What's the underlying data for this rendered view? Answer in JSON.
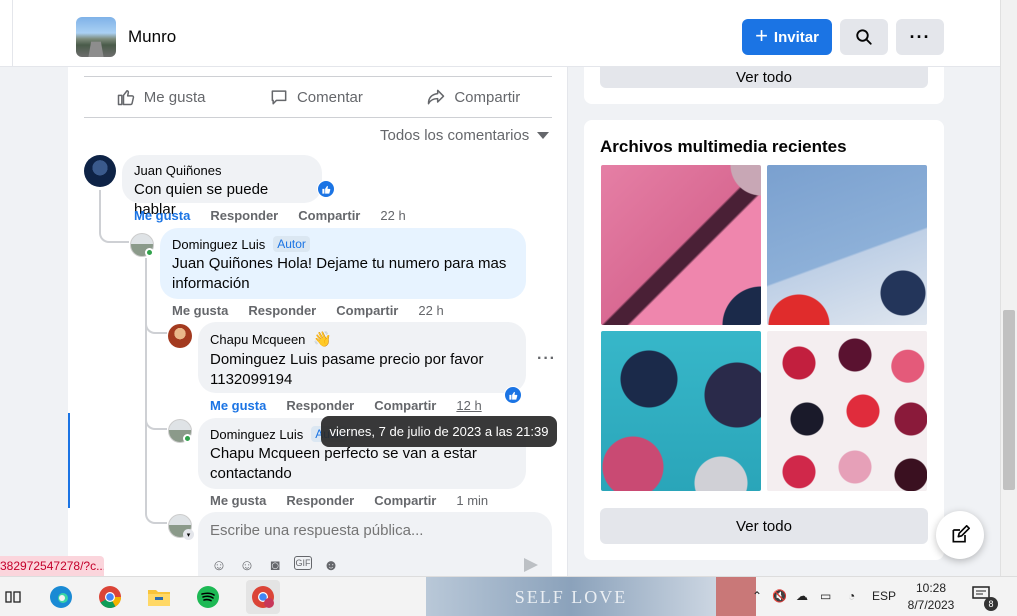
{
  "header": {
    "group_name": "Munro",
    "invite_label": "Invitar",
    "thumb_icon": "group-photo"
  },
  "post_actions": {
    "like": "Me gusta",
    "comment": "Comentar",
    "share": "Compartir"
  },
  "filter_label": "Todos los comentarios",
  "comments": [
    {
      "author": "Juan Quiñones",
      "text": "Con quien se puede hablar",
      "actions": [
        "Me gusta",
        "Responder",
        "Compartir"
      ],
      "time": "22 h",
      "liked": true
    },
    {
      "author": "Dominguez Luis",
      "badge": "Autor",
      "mention": "Juan Quiñones",
      "text": " Hola! Dejame tu numero para mas información",
      "actions": [
        "Me gusta",
        "Responder",
        "Compartir"
      ],
      "time": "22 h"
    },
    {
      "author": "Chapu Mcqueen",
      "mention": "Dominguez Luis",
      "text": " pasame precio por favor 1132099194",
      "actions": [
        "Me gusta",
        "Responder",
        "Compartir"
      ],
      "time": "12 h",
      "liked": true
    },
    {
      "author": "Dominguez Luis",
      "badge": "Autor",
      "mention": "Chapu Mcqueen",
      "text": " perfecto se van a estar contactando",
      "actions": [
        "Me gusta",
        "Responder",
        "Compartir"
      ],
      "time": "1 min"
    }
  ],
  "tooltip": "viernes, 7 de julio de 2023 a las 21:39",
  "reply": {
    "placeholder": "Escribe una respuesta pública..."
  },
  "sidebar": {
    "see_all_top": "Ver todo",
    "media_title": "Archivos multimedia recientes",
    "see_all_bottom": "Ver todo"
  },
  "url_status": "382972547278/?c...",
  "taskbar": {
    "wallpaper_text": "SELF LOVE",
    "lang": "ESP",
    "time": "10:28",
    "date": "8/7/2023",
    "notif_count": "8"
  },
  "colors": {
    "accent": "#1b74e4",
    "highlight": "#e7f3ff",
    "bubble": "#f0f2f5"
  }
}
